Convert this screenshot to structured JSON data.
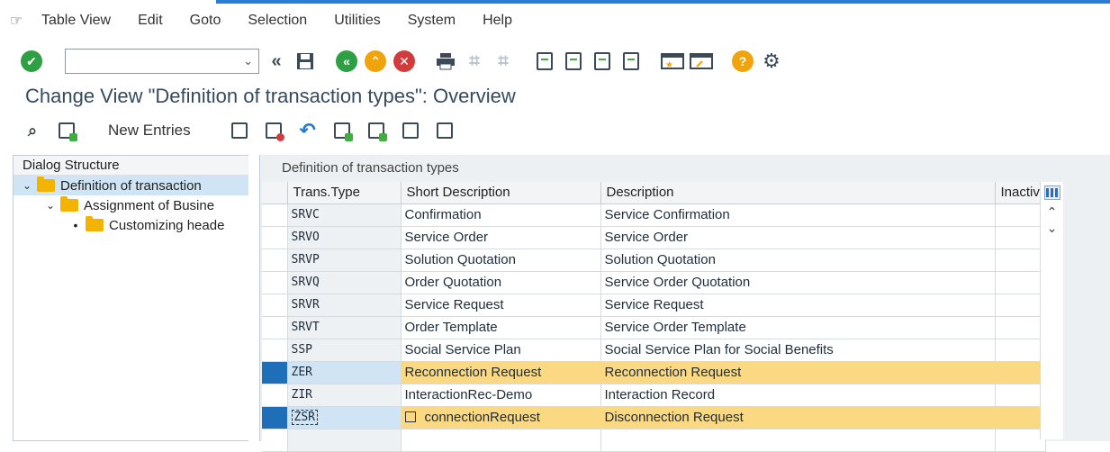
{
  "menu": [
    "Table View",
    "Edit",
    "Goto",
    "Selection",
    "Utilities",
    "System",
    "Help"
  ],
  "toolbar": {
    "command_field_value": "",
    "icons": [
      "enter-icon",
      "back-double-icon",
      "save-icon",
      "back-icon",
      "exit-icon",
      "cancel-icon",
      "print-icon",
      "find-icon",
      "find-next-icon",
      "first-page-icon",
      "previous-page-icon",
      "next-page-icon",
      "last-page-icon",
      "create-session-icon",
      "shortcut-icon",
      "help-icon",
      "settings-icon"
    ]
  },
  "page_title": "Change View \"Definition of transaction types\": Overview",
  "app_toolbar": {
    "new_entries": "New Entries"
  },
  "dialog_structure": {
    "header": "Dialog Structure",
    "nodes": [
      {
        "label": "Definition of transaction"
      },
      {
        "label": "Assignment of Busine"
      },
      {
        "label": "Customizing heade"
      }
    ]
  },
  "table": {
    "title": "Definition of transaction types",
    "columns": [
      "Trans.Type",
      "Short Description",
      "Description",
      "Inactiv"
    ],
    "rows": [
      {
        "type": "SRVC",
        "short": "Confirmation",
        "desc": "Service Confirmation",
        "highlight": false
      },
      {
        "type": "SRVO",
        "short": "Service Order",
        "desc": "Service Order",
        "highlight": false
      },
      {
        "type": "SRVP",
        "short": "Solution Quotation",
        "desc": "Solution Quotation",
        "highlight": false
      },
      {
        "type": "SRVQ",
        "short": "Order Quotation",
        "desc": "Service Order Quotation",
        "highlight": false
      },
      {
        "type": "SRVR",
        "short": "Service Request",
        "desc": "Service Request",
        "highlight": false
      },
      {
        "type": "SRVT",
        "short": "Order Template",
        "desc": "Service Order Template",
        "highlight": false
      },
      {
        "type": "SSP",
        "short": "Social Service Plan",
        "desc": "Social Service Plan for Social Benefits",
        "highlight": false
      },
      {
        "type": "ZER",
        "short": "Reconnection Request",
        "desc": "Reconnection Request",
        "highlight": true
      },
      {
        "type": "ZIR",
        "short": "InteractionRec-Demo",
        "desc": "Interaction  Record",
        "highlight": false
      },
      {
        "type": "ZSR",
        "short": "connectionRequest",
        "desc": "Disconnection Request",
        "highlight": true
      }
    ]
  },
  "colors": {
    "accent": "#2a7dd4",
    "row_highlight": "#fbd882",
    "selector": "#1f6fb8"
  }
}
